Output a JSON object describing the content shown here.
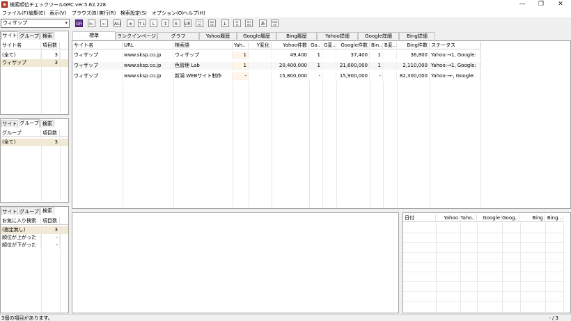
{
  "window": {
    "title": "検索順位チェックツールGRC  ver.5.62.228",
    "minimize_glyph": "—",
    "maximize_glyph": "❐",
    "close_glyph": "✕"
  },
  "menu": [
    "ファイル(F)",
    "編集(E)",
    "表示(V)",
    "ブラウズ(B)",
    "実行(R)",
    "検索設定(S)",
    "オプション(O)",
    "ヘルプ(H)"
  ],
  "toolbar": {
    "site_select_value": "ウィザップ",
    "buttons": [
      "GRC",
      "I←",
      "←",
      "ALL",
      "±",
      "↑↓",
      "L",
      "↕",
      "4-5",
      "URL",
      "TY PE",
      "NG DE",
      "1-1",
      "ST TE",
      "RO RD",
      "あ",
      "GRA UP"
    ]
  },
  "left_top": {
    "tabs": [
      "サイト",
      "グループ",
      "検索"
    ],
    "headers": [
      "サイト名",
      "項目数"
    ],
    "rows": [
      [
        "(全て)",
        "3"
      ],
      [
        "ウィザップ",
        "3"
      ]
    ]
  },
  "left_mid": {
    "tabs": [
      "サイト",
      "グループ",
      "検索"
    ],
    "headers": [
      "グループ",
      "項目数"
    ],
    "rows": [
      [
        "(全て)",
        "3"
      ]
    ]
  },
  "left_bot": {
    "tabs": [
      "サイト",
      "グループ",
      "検索"
    ],
    "headers": [
      "お気に入り検索",
      "項目数"
    ],
    "rows": [
      [
        "(指定無し)",
        "3"
      ],
      [
        "順位が上がった",
        "-"
      ],
      [
        "順位が下がった",
        "-"
      ]
    ]
  },
  "main": {
    "tabs": [
      "標準",
      "ランクインページ",
      "グラフ",
      "Yahoo履歴",
      "Google履歴",
      "Bing履歴",
      "Yahoo詳細",
      "Google詳細",
      "Bing詳細"
    ],
    "headers": [
      "サイト名",
      "URL",
      "検索語",
      "Yah..",
      "Y変化",
      "Yahoo件数",
      "Go..",
      "G変..",
      "Google件数",
      "Bin..",
      "B変..",
      "Bing件数",
      "ステータス"
    ],
    "rows": [
      [
        "ウィザップ",
        "www.sksp.co.jp",
        "ウィザップ",
        "1",
        "",
        "49,400",
        "1",
        "",
        "37,400",
        "1",
        "",
        "36,800",
        "Yahoo:→1, Google:"
      ],
      [
        "ウィザップ",
        "www.sksp.co.jp",
        "色管理 Lab",
        "1",
        "",
        "20,400,000",
        "1",
        "",
        "21,600,000",
        "1",
        "",
        "2,110,000",
        "Yahoo:→1, Google:"
      ],
      [
        "ウィザップ",
        "www.sksp.co.jp",
        "新潟 WEBサイト制作",
        "-",
        "",
        "15,800,000",
        "-",
        "",
        "15,900,000",
        "-",
        "",
        "82,300,000",
        "Yahoo:→-, Google:"
      ]
    ]
  },
  "history": {
    "headers": [
      "日付",
      "Yahoo",
      "Yaho..",
      "Google",
      "Goog..",
      "Bing",
      "Bing.."
    ]
  },
  "status": {
    "text": "3個の項目があります。",
    "page": "- / 3"
  },
  "colors": {
    "selected_row": "#f2e9d4",
    "grc_button": "#5b2d8e"
  }
}
